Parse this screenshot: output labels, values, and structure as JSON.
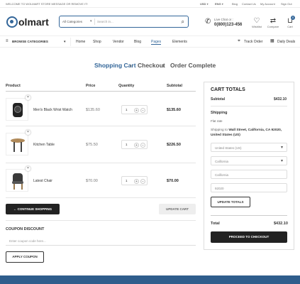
{
  "topbar": {
    "welcome": "WELCOME TO WOLMART STORE MESSAGE OR REMOVE IT!",
    "currency": "USD",
    "language": "ENG",
    "links": [
      "Blog",
      "Contact Us",
      "My Account",
      "Sign Out"
    ]
  },
  "header": {
    "logo": "olmart",
    "search": {
      "category": "All Categories",
      "placeholder": "Search in..."
    },
    "live_chat_label": "Live Chat or :",
    "phone": "0(800)123-456",
    "wishlist_label": "Wishlist",
    "compare_label": "Compare",
    "cart_label": "Cart",
    "cart_count": "0"
  },
  "nav": {
    "browse": "BROWSE CATEGORIES",
    "items": [
      "Home",
      "Shop",
      "Vendor",
      "Blog",
      "Pages",
      "Elements"
    ],
    "track_order": "Track Order",
    "daily_deals": "Daily Deals"
  },
  "steps": {
    "cart": "Shopping Cart",
    "checkout": "Checkout",
    "complete": "Order Complete"
  },
  "table": {
    "headers": {
      "product": "Product",
      "price": "Price",
      "quantity": "Quantity",
      "subtotal": "Subtotal"
    },
    "rows": [
      {
        "name": "Men's Black Wrist Watch",
        "price": "$135.60",
        "qty": "1",
        "subtotal": "$135.60"
      },
      {
        "name": "Kitchen Table",
        "price": "$75.50",
        "qty": "1",
        "subtotal": "$226.50"
      },
      {
        "name": "Latest Chair",
        "price": "$70.00",
        "qty": "1",
        "subtotal": "$70.00"
      }
    ]
  },
  "actions": {
    "continue": "CONTINUE SHOPPING",
    "update": "UPDATE CART"
  },
  "coupon": {
    "title": "COUPON DISCOUNT",
    "placeholder": "Enter coupon code here...",
    "apply": "APPLY COUPON"
  },
  "totals": {
    "title": "CART TOTALS",
    "subtotal_label": "Subtotal",
    "subtotal_value": "$432.10",
    "shipping_label": "Shipping",
    "flat_rate": "Flat rate",
    "shipping_to_prefix": "Shipping to",
    "shipping_address": "Wall Street, California, CA 92020, United States (US)",
    "country": "United States (US)",
    "state": "California",
    "city": "California",
    "zip": "92020",
    "update_totals": "UPDATE TOTALS",
    "total_label": "Total",
    "total_value": "$432.10",
    "checkout": "PROCEED TO CHECKOUT"
  },
  "icons": {
    "search": "search-icon",
    "phone": "phone-icon",
    "wishlist": "heart-icon",
    "compare": "compare-icon",
    "cart": "cart-icon"
  },
  "colors": {
    "brand": "#336699",
    "dark": "#222222",
    "footer": "#2f5d8c"
  }
}
